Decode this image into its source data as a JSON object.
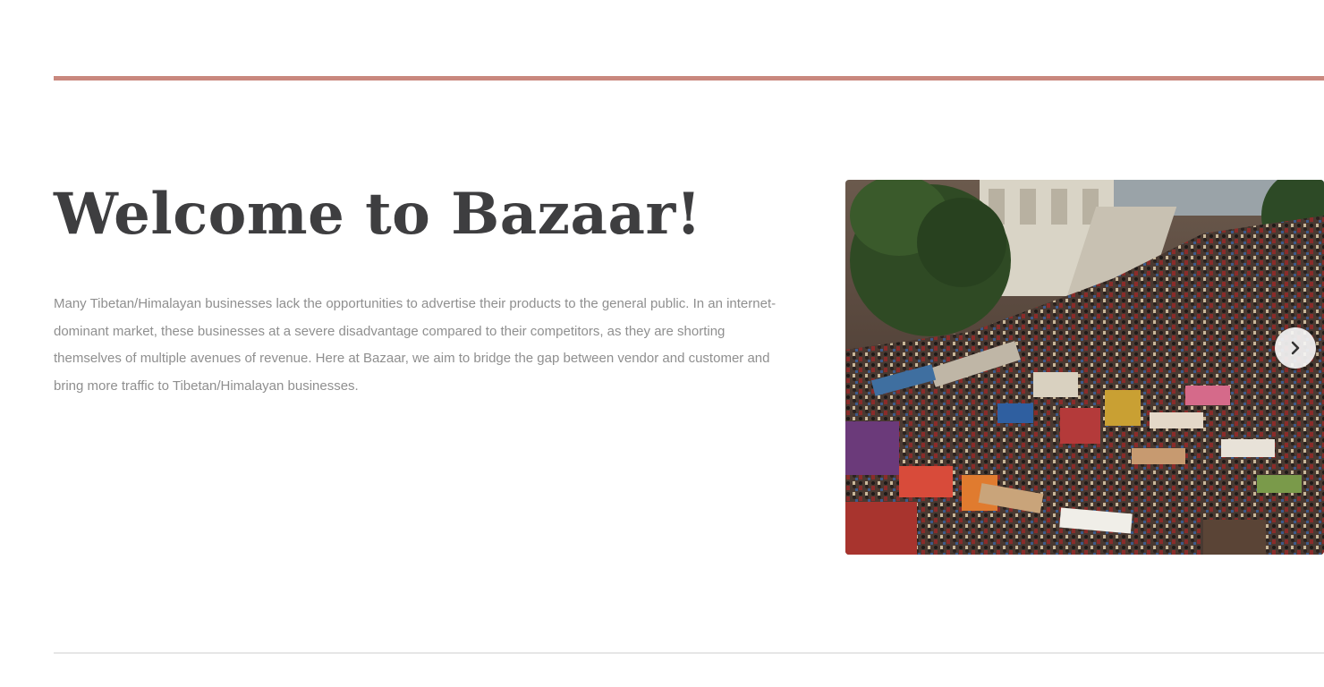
{
  "hero": {
    "title": "Welcome to Bazaar!",
    "description": "Many Tibetan/Himalayan businesses lack the opportunities to advertise their products to the general public. In an internet-dominant market, these businesses at a severe disadvantage compared to their competitors, as they are shorting themselves of multiple avenues of revenue. Here at Bazaar, we aim to bridge the gap between vendor and customer and bring more traffic to Tibetan/Himalayan businesses."
  },
  "carousel": {
    "next_icon": "chevron-right-icon"
  },
  "colors": {
    "accent_rule": "#c9887e",
    "title": "#3e3e40",
    "body_text": "#8f8f8f"
  }
}
